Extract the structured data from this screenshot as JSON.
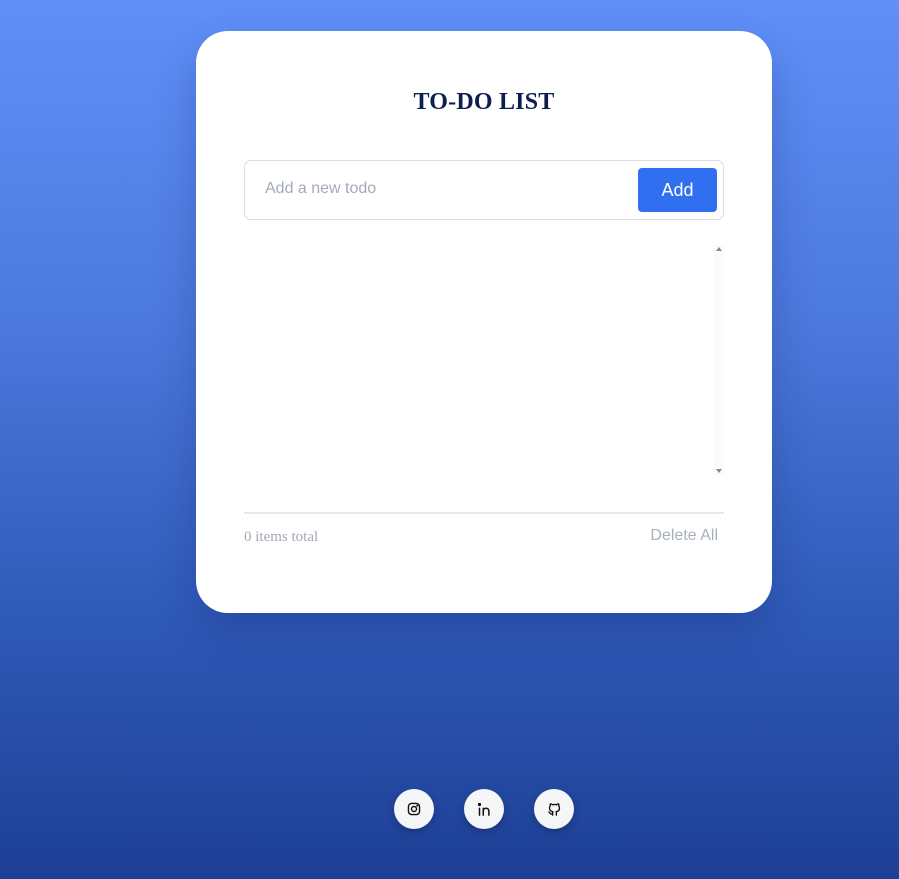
{
  "app": {
    "title": "TO-DO LIST"
  },
  "input": {
    "placeholder": "Add a new todo",
    "value": ""
  },
  "buttons": {
    "add_label": "Add",
    "delete_all_label": "Delete All"
  },
  "footer": {
    "count_text": "0 items total"
  },
  "todos": [],
  "social": [
    {
      "icon": "instagram-icon"
    },
    {
      "icon": "linkedin-icon"
    },
    {
      "icon": "github-icon"
    }
  ],
  "colors": {
    "accent": "#2f6ff0",
    "title": "#0d1f4f",
    "background_top": "#6090f8",
    "background_bottom": "#1d3f95"
  }
}
